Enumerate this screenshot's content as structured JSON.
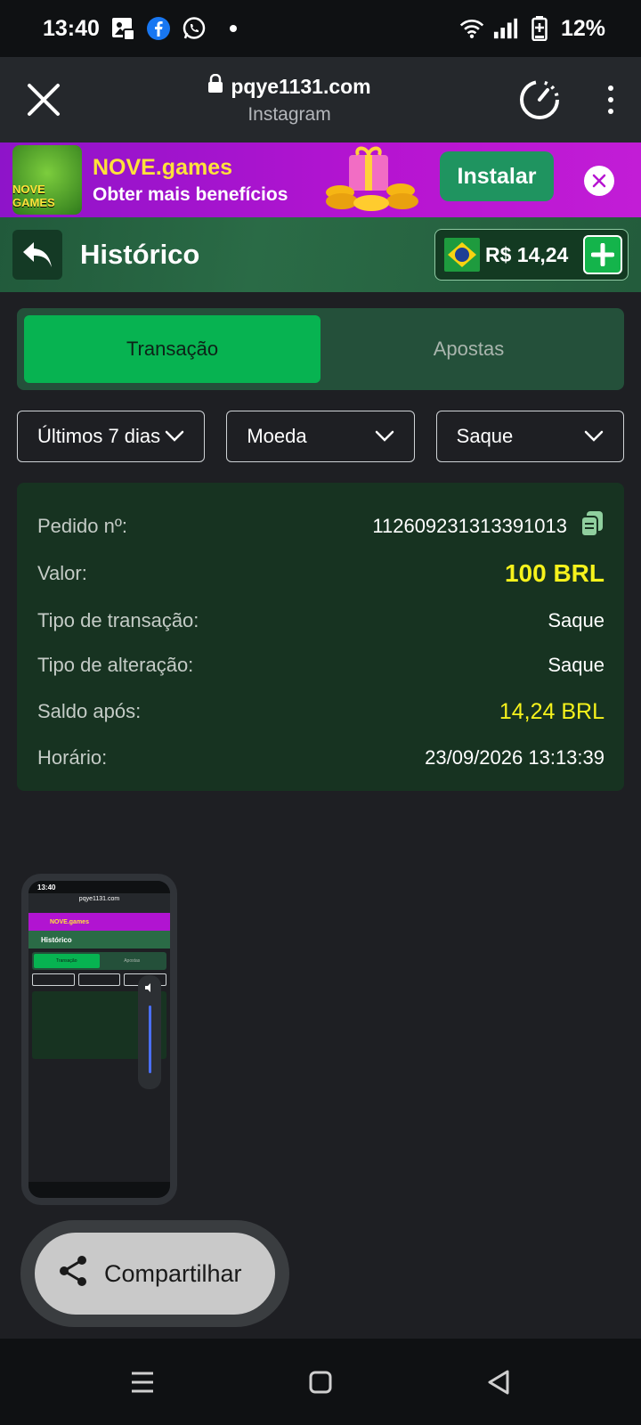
{
  "status_bar": {
    "time": "13:40",
    "battery": "12%",
    "icons": [
      "gallery-icon",
      "facebook-icon",
      "whatsapp-icon",
      "wifi-icon",
      "signal-icon",
      "battery-icon"
    ]
  },
  "browser": {
    "url": "pqye1131.com",
    "source": "Instagram"
  },
  "promo": {
    "logo_text": "NOVE GAMES",
    "title": "NOVE.games",
    "subtitle": "Obter mais benefícios",
    "install_label": "Instalar"
  },
  "header": {
    "title": "Histórico",
    "balance": "R$ 14,24"
  },
  "tabs": [
    {
      "label": "Transação",
      "active": true
    },
    {
      "label": "Apostas",
      "active": false
    }
  ],
  "filters": {
    "period": "Últimos 7 dias",
    "currency": "Moeda",
    "type": "Saque"
  },
  "details": {
    "order_label": "Pedido nº:",
    "order_value": "112609231313391013",
    "amount_label": "Valor:",
    "amount_value": "100 BRL",
    "tx_type_label": "Tipo de transação:",
    "tx_type_value": "Saque",
    "change_type_label": "Tipo de alteração:",
    "change_type_value": "Saque",
    "balance_after_label": "Saldo após:",
    "balance_after_value": "14,24 BRL",
    "time_label": "Horário:",
    "time_value": "23/09/2026 13:13:39"
  },
  "preview": {
    "time": "13:40",
    "url": "pqye1131.com",
    "promo": "NOVE.games",
    "title": "Histórico",
    "tab_active": "Transação",
    "tab_inactive": "Apostas"
  },
  "share": {
    "label": "Compartilhar"
  },
  "colors": {
    "accent_green": "#07b351",
    "highlight_yellow": "#f6f21c",
    "card_bg": "#173321",
    "promo_purple": "#b614d1"
  }
}
